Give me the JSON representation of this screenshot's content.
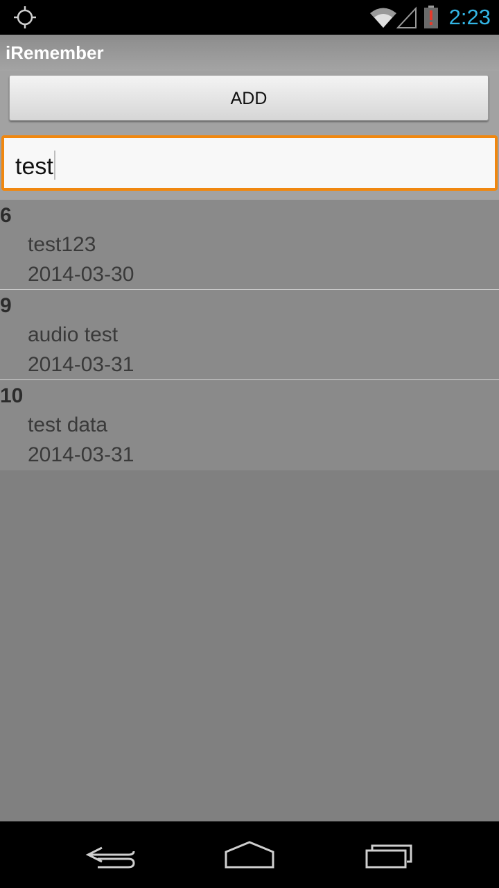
{
  "status_bar": {
    "time": "2:23",
    "icons": [
      "gps-icon",
      "wifi-icon",
      "signal-icon",
      "battery-alert-icon"
    ],
    "clock_color": "#33b5e5"
  },
  "app": {
    "title": "iRemember"
  },
  "toolbar": {
    "add_label": "ADD"
  },
  "search": {
    "value": "test",
    "accent_color": "#f0870f"
  },
  "list": {
    "items": [
      {
        "id": "6",
        "text": "test123",
        "date": "2014-03-30"
      },
      {
        "id": "9",
        "text": "audio test",
        "date": "2014-03-31"
      },
      {
        "id": "10",
        "text": "test data",
        "date": "2014-03-31"
      }
    ]
  },
  "nav_bar": {
    "icons": [
      "back-icon",
      "home-icon",
      "recent-apps-icon"
    ]
  }
}
